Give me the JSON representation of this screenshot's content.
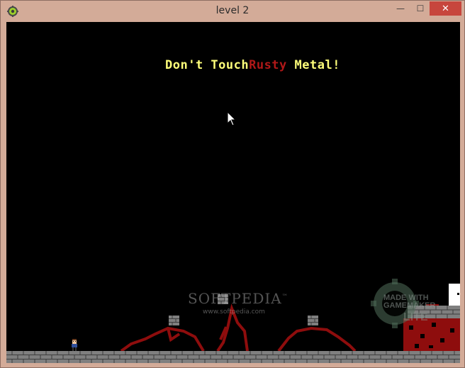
{
  "window": {
    "title": "level 2",
    "minimize_glyph": "—",
    "maximize_glyph": "☐",
    "close_glyph": "✕",
    "app_icon": "gamemaker-icon"
  },
  "game": {
    "hint": {
      "part1": "Don't Touch",
      "part2": "Rusty",
      "part3": " Metal!",
      "color_main": "#ffff7a",
      "color_accent": "#b01818"
    },
    "watermark": {
      "title": "SOFTPEDIA",
      "trademark": "™",
      "url": "www.softpedia.com"
    },
    "badge": {
      "line1": "MADE WITH",
      "line2": "GAMEMAKER",
      "line3": "LITE"
    },
    "colors": {
      "background": "#000000",
      "rust": "#8e0d0d",
      "brick": "#7f7f7f",
      "exit": "#ffffff"
    }
  }
}
